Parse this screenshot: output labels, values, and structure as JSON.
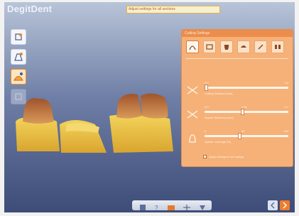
{
  "app": {
    "brand": "DegitDent"
  },
  "hint": {
    "text": "Adjust settings for all sections"
  },
  "toolbar": {
    "tools": [
      {
        "icon": "tooth-edit-icon",
        "state": "normal"
      },
      {
        "icon": "tooth-add-icon",
        "state": "normal"
      },
      {
        "icon": "tooth-shape-icon",
        "state": "active"
      },
      {
        "icon": "tooth-inactive-icon",
        "state": "disabled"
      }
    ]
  },
  "panel": {
    "title": "Cutting Settings",
    "tabs": [
      {
        "icon": "arch-icon",
        "active": true
      },
      {
        "icon": "screen-icon",
        "active": false
      },
      {
        "icon": "single-tooth-icon",
        "active": false
      },
      {
        "icon": "tooth-cap-icon",
        "active": false
      },
      {
        "icon": "pencil-icon",
        "active": false
      },
      {
        "icon": "multi-tooth-icon",
        "active": false
      }
    ],
    "sliders": [
      {
        "label": "Cutting Distance [mm]",
        "min": "0.0",
        "max": "1.0",
        "value": 0.0,
        "icon": "scissors-icon"
      },
      {
        "label": "Spacer thickness [mm]",
        "min": "0.0",
        "mid": "0.05",
        "max": "0.1",
        "value": 0.45,
        "icon": "scissors-icon"
      },
      {
        "label": "Spacer coverage [%]",
        "min": "0",
        "mid": "50",
        "max": "100",
        "value": 0.42,
        "icon": "bell-icon"
      }
    ],
    "checkbox": {
      "label": "Apply settings to all copings",
      "checked": false
    }
  },
  "bottom_bar": {
    "buttons": [
      "save-icon",
      "help-icon",
      "camera-icon",
      "expand-icon",
      "settings-icon"
    ]
  },
  "nav": {
    "back": "back-arrow-icon",
    "next": "next-arrow-icon"
  },
  "colors": {
    "accent": "#ec8d4c",
    "panel": "#f6b178",
    "background": "#6f7fa6",
    "tooth": "#c98a4a",
    "gum": "#e7bb3d"
  }
}
